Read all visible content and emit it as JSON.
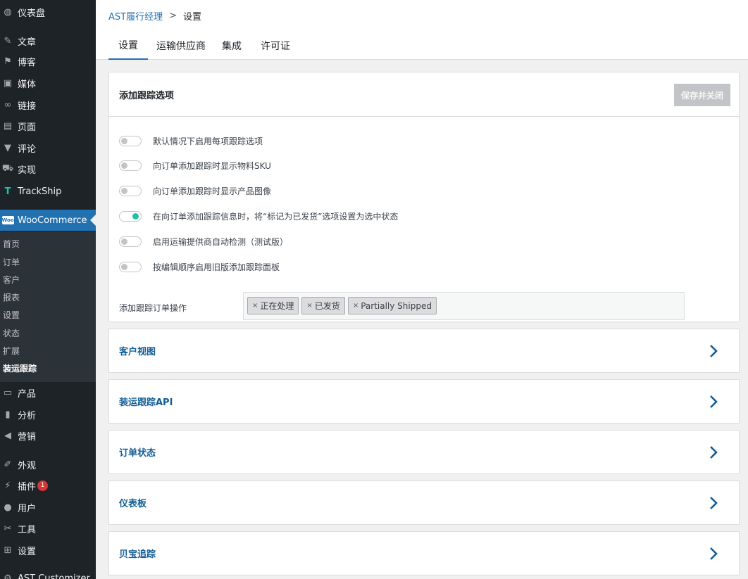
{
  "sidebar": {
    "items": [
      {
        "label": "仪表盘",
        "icon": "dashboard-icon",
        "glyph": "◍"
      },
      {
        "label": "文章",
        "icon": "pin-icon",
        "glyph": "✎"
      },
      {
        "label": "博客",
        "icon": "flag-icon",
        "glyph": "⚑"
      },
      {
        "label": "媒体",
        "icon": "media-icon",
        "glyph": "▣"
      },
      {
        "label": "链接",
        "icon": "link-icon",
        "glyph": "∞"
      },
      {
        "label": "页面",
        "icon": "page-icon",
        "glyph": "▤"
      },
      {
        "label": "评论",
        "icon": "comment-icon",
        "glyph": "▼"
      },
      {
        "label": "实现",
        "icon": "fulfillment-icon",
        "glyph": "⛟"
      },
      {
        "label": "TrackShip",
        "icon": "trackship-icon",
        "glyph": "T"
      },
      {
        "label": "WooCommerce",
        "icon": "woocommerce-icon",
        "glyph": "W"
      },
      {
        "label": "产品",
        "icon": "archive-icon",
        "glyph": "▭"
      },
      {
        "label": "分析",
        "icon": "chart-bar-icon",
        "glyph": "▮"
      },
      {
        "label": "营销",
        "icon": "megaphone-icon",
        "glyph": "◀"
      },
      {
        "label": "外观",
        "icon": "brush-icon",
        "glyph": "✐"
      },
      {
        "label": "插件",
        "icon": "plugin-icon",
        "glyph": "⚡",
        "badge": "1"
      },
      {
        "label": "用户",
        "icon": "user-icon",
        "glyph": "●"
      },
      {
        "label": "工具",
        "icon": "wrench-icon",
        "glyph": "✂"
      },
      {
        "label": "设置",
        "icon": "settings-icon",
        "glyph": "⊞"
      },
      {
        "label": "AST Customizer",
        "icon": "gear-icon",
        "glyph": "⚙"
      }
    ],
    "submenu": [
      "首页",
      "订单",
      "客户",
      "报表",
      "设置",
      "状态",
      "扩展",
      "装运跟踪"
    ]
  },
  "breadcrumb": {
    "parent": "AST履行经理",
    "separator": ">",
    "current": "设置"
  },
  "tabs": [
    "设置",
    "运输供应商",
    "集成",
    "许可证"
  ],
  "tracking_panel": {
    "title": "添加跟踪选项",
    "save_label": "保存并关闭",
    "options": [
      {
        "label": "默认情况下启用每项跟踪选项",
        "enabled": false
      },
      {
        "label": "向订单添加跟踪时显示物料SKU",
        "enabled": false
      },
      {
        "label": "向订单添加跟踪时显示产品图像",
        "enabled": false
      },
      {
        "label": "在向订单添加跟踪信息时，将“标记为已发货”选项设置为选中状态",
        "enabled": true
      },
      {
        "label": "启用运输提供商自动检测（测试版）",
        "enabled": false
      },
      {
        "label": "按编辑顺序启用旧版添加跟踪面板",
        "enabled": false
      }
    ],
    "actions_label": "添加跟踪订单操作",
    "actions": [
      "正在处理",
      "已发货",
      "Partially Shipped"
    ],
    "chip_remove": "×"
  },
  "accordions": [
    "客户视图",
    "装运跟踪API",
    "订单状态",
    "仪表板",
    "贝宝追踪"
  ],
  "colors": {
    "sidebar_bg": "#1d2327",
    "accent": "#2271b1",
    "toggle_on": "#1ec3a6",
    "badge": "#d63638"
  }
}
